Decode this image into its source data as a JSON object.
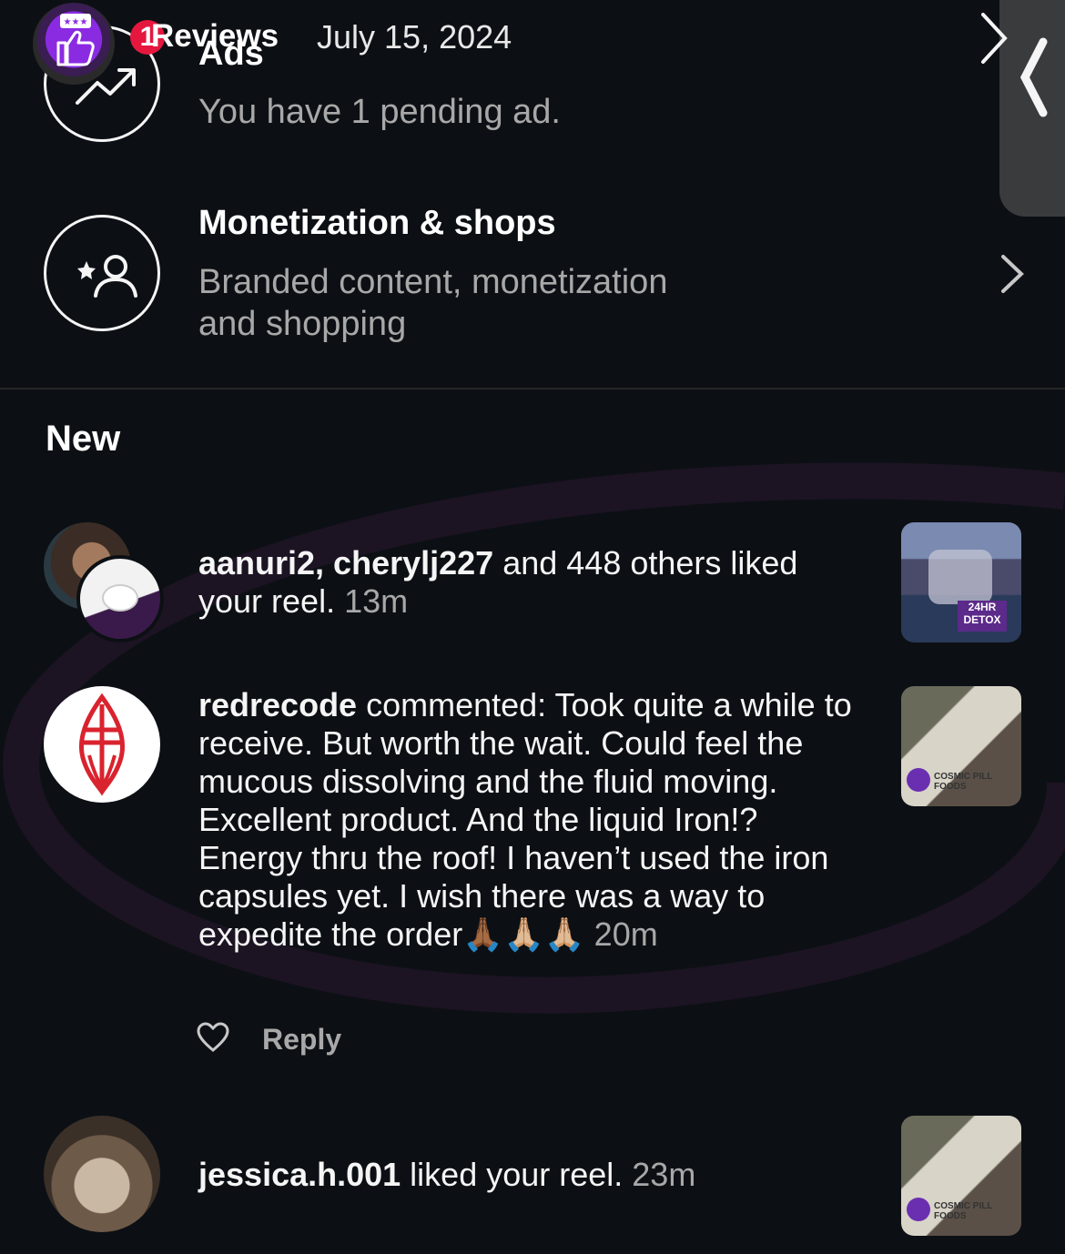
{
  "overlay": {
    "count": "1",
    "title": "Reviews",
    "date": "July 15, 2024"
  },
  "ads": {
    "title": "Ads",
    "subtitle": "You have 1 pending ad."
  },
  "monetization": {
    "title": "Monetization & shops",
    "subtitle_line1": "Branded content, monetization",
    "subtitle_line2": "and shopping"
  },
  "section_title": "New",
  "notifications": [
    {
      "users": "aanuri2, cherylj227",
      "rest": " and 448 others liked your reel. ",
      "time": "13m"
    },
    {
      "user": "redrecode",
      "text": " commented: Took quite a while to receive. But worth the wait. Could feel the mucous dissolving and the fluid moving. Excellent product. And the liquid Iron!? Energy thru the roof! I haven’t used the iron capsules yet. I wish there was a way to expedite the order🙏🏾🙏🏼🙏🏼 ",
      "time": "20m",
      "reply_label": "Reply"
    },
    {
      "user": "jessica.h.001",
      "text": " liked your reel. ",
      "time": "23m"
    }
  ],
  "thumbnail_text": {
    "detox": "24HR DETOX",
    "brand": "COSMIC PILL FOODS"
  }
}
